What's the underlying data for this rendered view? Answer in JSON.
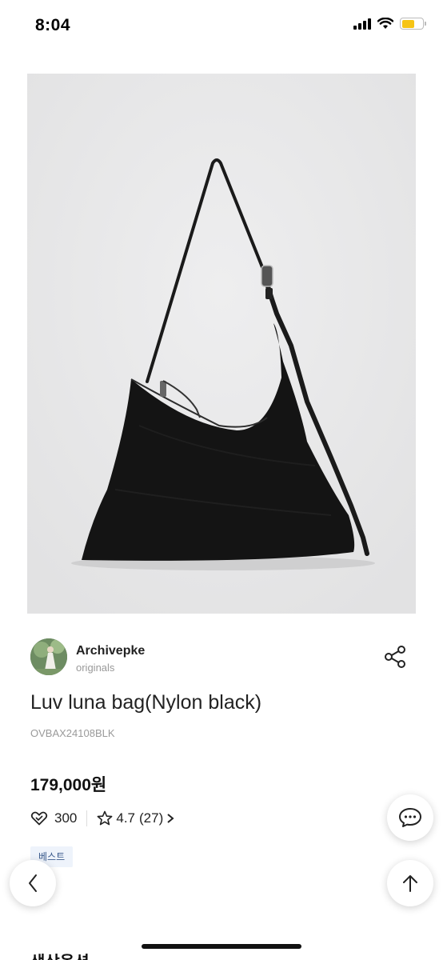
{
  "status_bar": {
    "time": "8:04",
    "icons": [
      "signal-icon",
      "wifi-icon",
      "battery-icon"
    ],
    "battery_color": "#f6c415"
  },
  "product": {
    "image_icon": "product-photo-black-shoulder-bag",
    "brand": {
      "name": "Archivepke",
      "subtitle": "originals"
    },
    "title": "Luv luna bag(Nylon black)",
    "code": "OVBAX24108BLK",
    "price": "179,000원",
    "likes": "300",
    "rating": "4.7",
    "reviews": "(27)",
    "badge": "베스트"
  },
  "actions": {
    "share_icon": "share-icon",
    "chat_icon": "chat-bubble-icon",
    "scroll_top_icon": "arrow-up-icon",
    "back_icon": "chevron-left-icon"
  },
  "section": {
    "heading": "색상옵션"
  },
  "colors": {
    "badge_bg": "#eef3fb",
    "badge_text": "#3a5a8c",
    "image_bg": "#e9e9e9"
  }
}
